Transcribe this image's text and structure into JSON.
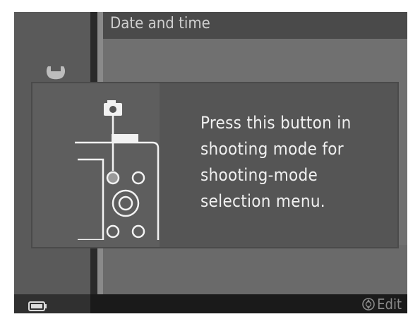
{
  "menu": {
    "title": "Date and time"
  },
  "popup": {
    "lines": [
      "Press this button in",
      "shooting mode for",
      "shooting-mode",
      "selection menu."
    ]
  },
  "footer": {
    "edit_label": "Edit"
  },
  "icons": {
    "setup": "wrench-icon",
    "battery": "battery-icon",
    "camera": "camera-icon",
    "multi_selector": "multi-selector-icon"
  },
  "colors": {
    "screen_bg": "#1c1c1c",
    "title_bar": "#4a4a4a",
    "content": "#707070",
    "popup": "#555555",
    "popup_text": "#f0f0f0"
  }
}
